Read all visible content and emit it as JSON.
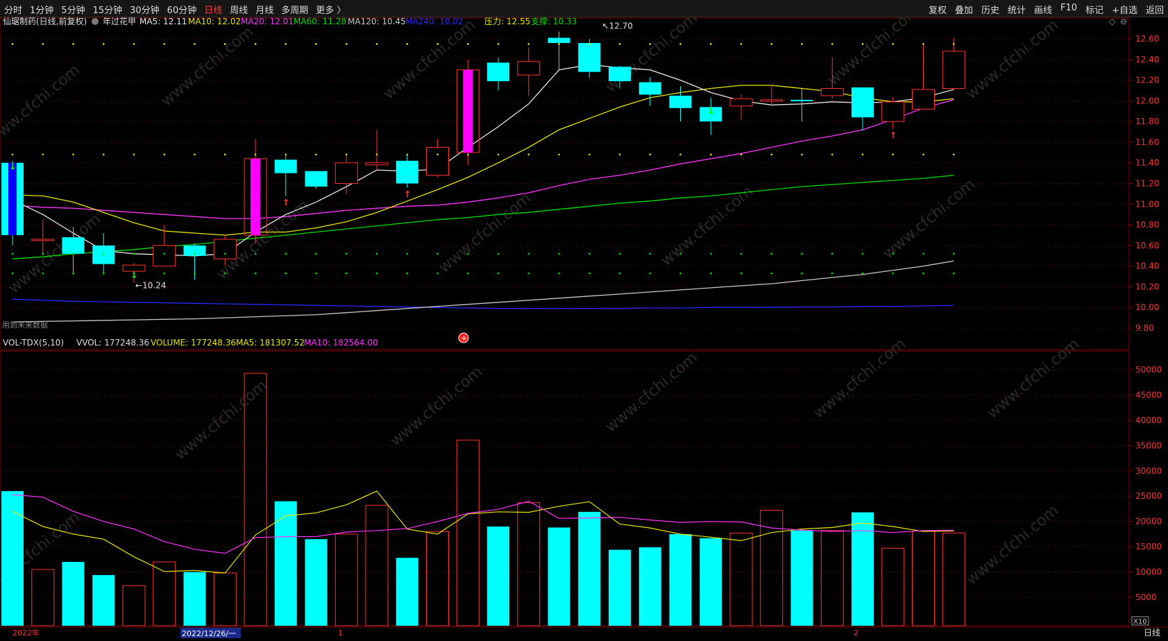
{
  "toolbar": {
    "left": [
      "分时",
      "1分钟",
      "5分钟",
      "15分钟",
      "30分钟",
      "60分钟",
      "日线",
      "周线",
      "月线",
      "多周期",
      "更多 〉"
    ],
    "active": "日线",
    "right": [
      "复权",
      "叠加",
      "历史",
      "统计",
      "画线",
      "F10",
      "标记",
      "+自选",
      "返回"
    ]
  },
  "main_info": {
    "name": "仙琚制药(日线,前复权)",
    "pattern": "年过花甲",
    "ma5": "MA5: 12.11",
    "ma10": "MA10: 12.02",
    "ma20": "MA20: 12.01",
    "ma60": "MA60: 11.28",
    "ma120": "MA120: 10.45",
    "ma240": "MA240: 10.02",
    "pressure": "压力: 12.55",
    "support": "支撑: 10.33"
  },
  "vol_info": {
    "name": "VOL-TDX(5,10)",
    "vvol": "VVOL: 177248.36",
    "volume": "VOLUME: 177248.36",
    "ma5": "MA5: 181307.52",
    "ma10": "MA10: 182564.00"
  },
  "annotations": {
    "high_label": "12.70",
    "low_label": "10.24",
    "future_note": "用到未来数据",
    "scale_label": "X10",
    "period_label": "日线"
  },
  "date_axis": {
    "year": "2022年",
    "cursor_date": "2022/12/26/一",
    "month1": "1",
    "month2": "2"
  },
  "colors": {
    "up": "#ff3232",
    "down": "#00ffff",
    "ma5": "#e8e8e8",
    "ma10": "#e8e800",
    "ma20": "#ff33ff",
    "ma60": "#00e000",
    "ma120": "#c8c8c8",
    "ma240": "#2828ff",
    "grid": "#7a0000",
    "watermark": "www.cfchi.com"
  },
  "chart_data": {
    "type": "candlestick",
    "price_axis": {
      "ylim": [
        9.7,
        12.7
      ],
      "ticks": [
        "12.60",
        "12.40",
        "12.20",
        "12.00",
        "11.80",
        "11.60",
        "11.40",
        "11.20",
        "11.00",
        "10.80",
        "10.60",
        "10.40",
        "10.20",
        "10.00",
        "9.80"
      ]
    },
    "volume_axis": {
      "ylim": [
        0,
        51000
      ],
      "ticks": [
        "50000",
        "45000",
        "40000",
        "35000",
        "30000",
        "25000",
        "20000",
        "15000",
        "10000",
        "5000"
      ]
    },
    "candles": [
      {
        "o": 11.4,
        "h": 11.42,
        "c": 10.7,
        "l": 10.6,
        "special": "big-down"
      },
      {
        "o": 10.65,
        "h": 10.85,
        "c": 10.66,
        "l": 10.5
      },
      {
        "o": 10.68,
        "h": 10.78,
        "c": 10.52,
        "l": 10.32
      },
      {
        "o": 10.6,
        "h": 10.72,
        "c": 10.42,
        "l": 10.33
      },
      {
        "o": 10.35,
        "h": 10.43,
        "c": 10.41,
        "l": 10.24
      },
      {
        "o": 10.4,
        "h": 10.8,
        "c": 10.6,
        "l": 10.4
      },
      {
        "o": 10.6,
        "h": 10.62,
        "c": 10.5,
        "l": 10.27
      },
      {
        "o": 10.47,
        "h": 10.7,
        "c": 10.66,
        "l": 10.4
      },
      {
        "o": 10.7,
        "h": 11.63,
        "c": 11.44,
        "l": 10.62,
        "special": "big-up"
      },
      {
        "o": 11.43,
        "h": 11.47,
        "c": 11.3,
        "l": 11.08
      },
      {
        "o": 11.32,
        "h": 11.32,
        "c": 11.17,
        "l": 11.15
      },
      {
        "o": 11.2,
        "h": 11.48,
        "c": 11.4,
        "l": 11.1
      },
      {
        "o": 11.38,
        "h": 11.72,
        "c": 11.4,
        "l": 11.33
      },
      {
        "o": 11.42,
        "h": 11.48,
        "c": 11.2,
        "l": 11.16
      },
      {
        "o": 11.28,
        "h": 11.63,
        "c": 11.55,
        "l": 11.26
      },
      {
        "o": 11.5,
        "h": 12.4,
        "c": 12.3,
        "l": 11.38,
        "special": "big-up"
      },
      {
        "o": 12.37,
        "h": 12.42,
        "c": 12.19,
        "l": 12.1
      },
      {
        "o": 12.25,
        "h": 12.52,
        "c": 12.38,
        "l": 12.05
      },
      {
        "o": 12.61,
        "h": 12.67,
        "c": 12.56,
        "l": 12.3
      },
      {
        "o": 12.56,
        "h": 12.6,
        "c": 12.28,
        "l": 12.22
      },
      {
        "o": 12.33,
        "h": 12.34,
        "c": 12.19,
        "l": 12.12
      },
      {
        "o": 12.18,
        "h": 12.23,
        "c": 12.06,
        "l": 11.95
      },
      {
        "o": 12.05,
        "h": 12.14,
        "c": 11.93,
        "l": 11.8
      },
      {
        "o": 11.94,
        "h": 12.03,
        "c": 11.8,
        "l": 11.67
      },
      {
        "o": 11.95,
        "h": 12.06,
        "c": 12.02,
        "l": 11.82
      },
      {
        "o": 12.0,
        "h": 12.16,
        "c": 12.01,
        "l": 11.95
      },
      {
        "o": 12.01,
        "h": 12.12,
        "c": 12.0,
        "l": 11.8
      },
      {
        "o": 12.05,
        "h": 12.42,
        "c": 12.12,
        "l": 12.02
      },
      {
        "o": 12.13,
        "h": 12.13,
        "c": 11.84,
        "l": 11.71
      },
      {
        "o": 11.8,
        "h": 12.04,
        "c": 11.99,
        "l": 11.73
      },
      {
        "o": 11.92,
        "h": 12.55,
        "c": 12.11,
        "l": 11.91
      },
      {
        "o": 12.12,
        "h": 12.61,
        "c": 12.48,
        "l": 12.1
      }
    ],
    "volume": [
      26000,
      10500,
      12000,
      9400,
      7300,
      12000,
      10000,
      9800,
      49300,
      24000,
      16500,
      17500,
      23200,
      12800,
      18000,
      36100,
      19000,
      23700,
      18800,
      21900,
      14400,
      14900,
      17500,
      16700,
      17700,
      22200,
      18200,
      18200,
      21800,
      14700,
      18100,
      17725
    ],
    "ma5": [
      11.04,
      10.9,
      10.72,
      10.55,
      10.52,
      10.51,
      10.5,
      10.52,
      10.73,
      10.9,
      11.02,
      11.17,
      11.33,
      11.32,
      11.34,
      11.55,
      11.75,
      11.97,
      12.3,
      12.35,
      12.32,
      12.3,
      12.2,
      12.08,
      12.0,
      11.96,
      11.97,
      11.99,
      11.98,
      11.99,
      12.03,
      12.11
    ],
    "ma10": [
      11.09,
      11.08,
      11.02,
      10.92,
      10.82,
      10.74,
      10.72,
      10.7,
      10.73,
      10.73,
      10.77,
      10.83,
      10.92,
      11.03,
      11.14,
      11.26,
      11.4,
      11.55,
      11.72,
      11.83,
      11.94,
      12.03,
      12.08,
      12.12,
      12.15,
      12.15,
      12.12,
      12.09,
      12.03,
      11.99,
      11.99,
      12.02
    ],
    "ma20": [
      10.99,
      10.97,
      10.96,
      10.94,
      10.92,
      10.9,
      10.88,
      10.86,
      10.86,
      10.88,
      10.91,
      10.94,
      10.96,
      10.98,
      10.99,
      11.02,
      11.06,
      11.11,
      11.18,
      11.24,
      11.28,
      11.33,
      11.39,
      11.44,
      11.49,
      11.55,
      11.61,
      11.66,
      11.72,
      11.82,
      11.93,
      12.01
    ],
    "ma60": [
      10.47,
      10.49,
      10.52,
      10.54,
      10.56,
      10.59,
      10.61,
      10.64,
      10.67,
      10.7,
      10.73,
      10.76,
      10.79,
      10.82,
      10.85,
      10.87,
      10.9,
      10.92,
      10.95,
      10.98,
      11.01,
      11.03,
      11.06,
      11.08,
      11.11,
      11.14,
      11.17,
      11.19,
      11.21,
      11.23,
      11.25,
      11.28
    ],
    "ma120": [
      9.86,
      9.865,
      9.87,
      9.875,
      9.88,
      9.885,
      9.89,
      9.9,
      9.91,
      9.92,
      9.93,
      9.95,
      9.97,
      9.99,
      10.01,
      10.03,
      10.05,
      10.07,
      10.09,
      10.11,
      10.13,
      10.15,
      10.17,
      10.19,
      10.21,
      10.23,
      10.26,
      10.29,
      10.32,
      10.36,
      10.4,
      10.45
    ],
    "ma240": [
      10.08,
      10.07,
      10.06,
      10.055,
      10.05,
      10.045,
      10.04,
      10.035,
      10.03,
      10.025,
      10.02,
      10.015,
      10.01,
      10.005,
      10.0,
      9.995,
      9.99,
      9.99,
      9.99,
      9.99,
      9.99,
      9.995,
      9.995,
      10.0,
      10.0,
      10.0,
      10.005,
      10.005,
      10.01,
      10.01,
      10.015,
      10.02
    ],
    "vol_ma5": [
      22000,
      19000,
      17500,
      16500,
      13000,
      10100,
      10300,
      9800,
      17300,
      21100,
      21700,
      23300,
      26000,
      18500,
      17500,
      21500,
      21900,
      21800,
      23000,
      23900,
      19500,
      18700,
      17500,
      16900,
      16200,
      17800,
      18500,
      18800,
      19700,
      19000,
      18000,
      18131
    ],
    "vol_ma10": [
      25300,
      24800,
      22000,
      20000,
      18500,
      16000,
      14500,
      13700,
      16800,
      17000,
      17000,
      17900,
      18200,
      18600,
      20000,
      21600,
      22400,
      24000,
      20600,
      20700,
      20800,
      20300,
      19800,
      20000,
      19900,
      18700,
      18300,
      18000,
      18200,
      17800,
      18200,
      18256
    ],
    "signal_arrows": [
      {
        "i": 0,
        "dir": "down",
        "color": "#00ff00"
      },
      {
        "i": 4,
        "dir": "down",
        "color": "#00ff00"
      },
      {
        "i": 9,
        "dir": "up",
        "color": "#ff3232"
      },
      {
        "i": 13,
        "dir": "up",
        "color": "#ff3232"
      },
      {
        "i": 23,
        "dir": "down",
        "color": "#00ff00"
      },
      {
        "i": 29,
        "dir": "up",
        "color": "#ff3232"
      }
    ]
  }
}
